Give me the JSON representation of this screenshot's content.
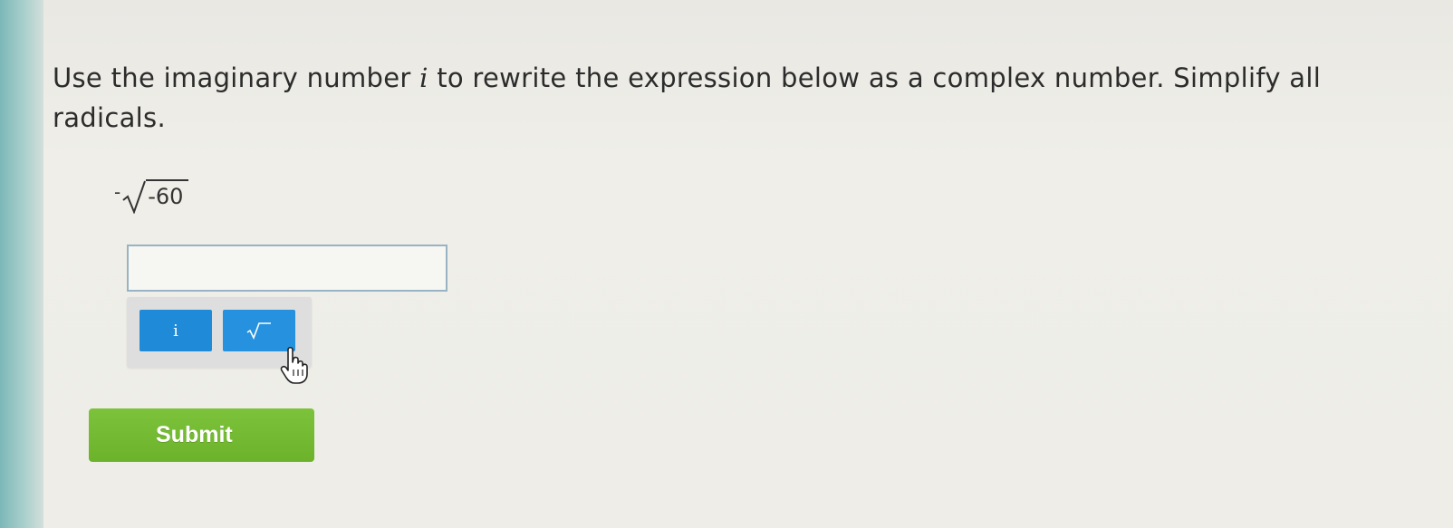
{
  "question": {
    "text_before_var": "Use the imaginary number ",
    "var": "i",
    "text_after_var": " to rewrite the expression below as a complex number. Simplify all radicals."
  },
  "expression": {
    "sign": "-",
    "radicand": "-60"
  },
  "answer": {
    "value": "",
    "placeholder": ""
  },
  "toolbar": {
    "i_label": "i",
    "sqrt_icon": "square-root-icon"
  },
  "submit": {
    "label": "Submit"
  },
  "colors": {
    "toolbar_button": "#1f8ad8",
    "submit_button": "#74bb32",
    "input_border": "#9ab3c4",
    "left_strip": "#7cb8b8"
  }
}
